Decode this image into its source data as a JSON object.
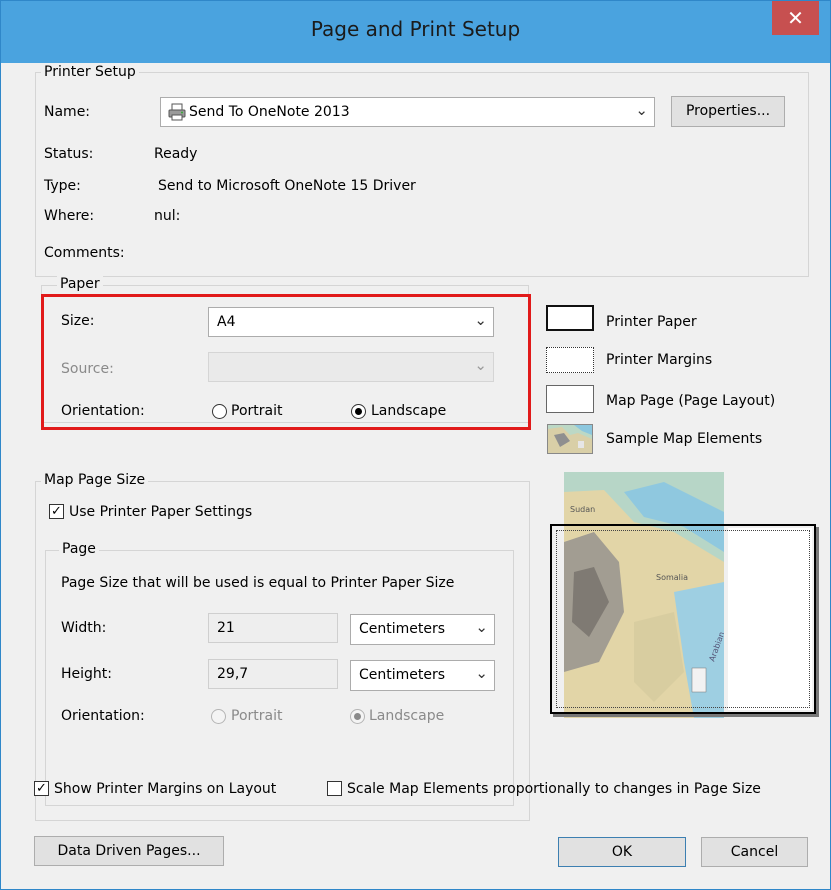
{
  "window": {
    "title": "Page and Print Setup",
    "close_symbol": "✕"
  },
  "printer_setup": {
    "legend": "Printer Setup",
    "name_label": "Name:",
    "name_value": "Send To OneNote 2013",
    "properties_button": "Properties...",
    "status_label": "Status:",
    "status_value": "Ready",
    "type_label": "Type:",
    "type_value": "Send to Microsoft OneNote 15 Driver",
    "where_label": "Where:",
    "where_value": "nul:",
    "comments_label": "Comments:"
  },
  "paper": {
    "legend": "Paper",
    "size_label": "Size:",
    "size_value": "A4",
    "source_label": "Source:",
    "source_value": "",
    "orientation_label": "Orientation:",
    "portrait_label": "Portrait",
    "landscape_label": "Landscape",
    "orientation_selected": "Landscape"
  },
  "legend_panel": {
    "printer_paper": "Printer Paper",
    "printer_margins": "Printer Margins",
    "map_page": "Map Page (Page Layout)",
    "sample_map": "Sample Map Elements",
    "preview_map_labels": [
      "Sudan",
      "Somalia",
      "Arabian"
    ]
  },
  "map_page_size": {
    "legend": "Map Page Size",
    "use_printer_paper_label": "Use Printer Paper Settings",
    "use_printer_paper_checked": true,
    "page_legend": "Page",
    "page_info": "Page Size that will be used is equal to Printer Paper Size",
    "width_label": "Width:",
    "width_value": "21",
    "width_unit": "Centimeters",
    "height_label": "Height:",
    "height_value": "29,7",
    "height_unit": "Centimeters",
    "orientation_label": "Orientation:",
    "portrait_label": "Portrait",
    "landscape_label": "Landscape"
  },
  "options": {
    "show_margins_label": "Show Printer Margins on Layout",
    "show_margins_checked": true,
    "scale_elements_label": "Scale Map Elements proportionally to changes in Page Size",
    "scale_elements_checked": false
  },
  "buttons": {
    "data_driven": "Data Driven Pages...",
    "ok": "OK",
    "cancel": "Cancel"
  },
  "colors": {
    "titlebar": "#4aa3df",
    "close": "#c75050",
    "highlight": "#e11a1a"
  }
}
